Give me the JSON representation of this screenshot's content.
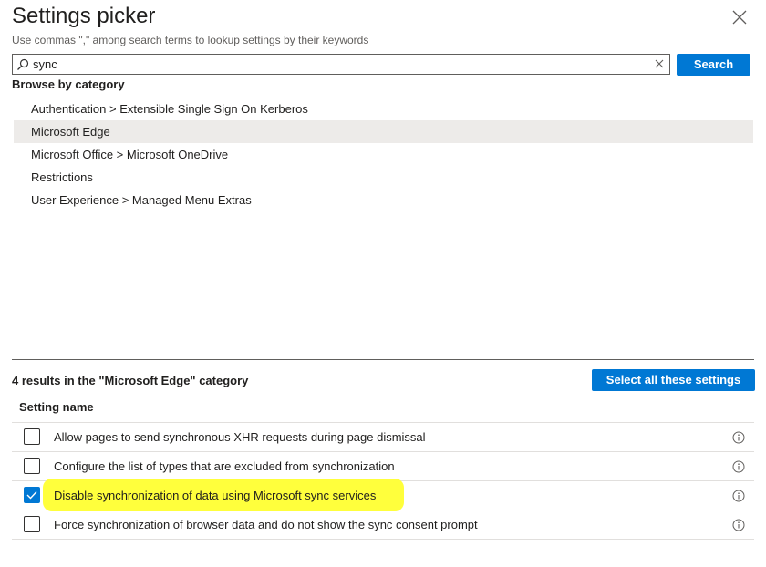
{
  "header": {
    "title": "Settings picker",
    "subtitle": "Use commas \",\" among search terms to lookup settings by their keywords"
  },
  "search": {
    "value": "sync",
    "button_label": "Search"
  },
  "browse": {
    "label": "Browse by category",
    "categories": [
      {
        "label": "Authentication > Extensible Single Sign On Kerberos",
        "selected": false
      },
      {
        "label": "Microsoft Edge",
        "selected": true
      },
      {
        "label": "Microsoft Office > Microsoft OneDrive",
        "selected": false
      },
      {
        "label": "Restrictions",
        "selected": false
      },
      {
        "label": "User Experience > Managed Menu Extras",
        "selected": false
      }
    ]
  },
  "results": {
    "summary": "4 results in the \"Microsoft Edge\" category",
    "select_all_label": "Select all these settings",
    "column_header": "Setting name",
    "rows": [
      {
        "label": "Allow pages to send synchronous XHR requests during page dismissal",
        "checked": false
      },
      {
        "label": "Configure the list of types that are excluded from synchronization",
        "checked": false
      },
      {
        "label": "Disable synchronization of data using Microsoft sync services",
        "checked": true
      },
      {
        "label": "Force synchronization of browser data and do not show the sync consent prompt",
        "checked": false
      }
    ]
  },
  "colors": {
    "accent": "#0078d4",
    "selected_row": "#edebe9",
    "highlight": "#ffff3c"
  },
  "icons": {
    "close": "close-icon",
    "search": "search-icon",
    "clear": "clear-icon",
    "info": "info-icon",
    "check": "checkmark-icon"
  }
}
